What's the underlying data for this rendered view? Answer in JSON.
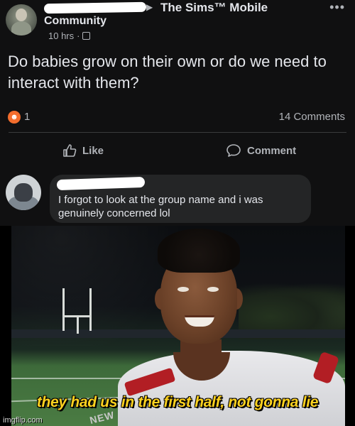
{
  "post": {
    "group_name": "The Sims™ Mobile",
    "author_line": "Community",
    "timestamp": "10 hrs",
    "question": "Do babies grow on their own or do we need to interact with them?",
    "reaction_count": "1",
    "comments_count": "14 Comments",
    "like_label": "Like",
    "comment_label": "Comment"
  },
  "comment": {
    "text": "I forgot to look at the group name and i was genuinely concerned lol"
  },
  "meme": {
    "caption": "they had us in the first half, not gonna lie",
    "mic_flag": "NEW",
    "watermark": "imgflip.com"
  },
  "colors": {
    "caption": "#ffd21f",
    "reaction_badge": "#f36d2d",
    "jersey_accent": "#b21e24"
  },
  "icons": {
    "reaction": "haha-reaction-icon",
    "like": "thumbs-up-icon",
    "comment": "speech-bubble-icon",
    "privacy": "group-privacy-icon",
    "more": "more-dots-icon"
  }
}
